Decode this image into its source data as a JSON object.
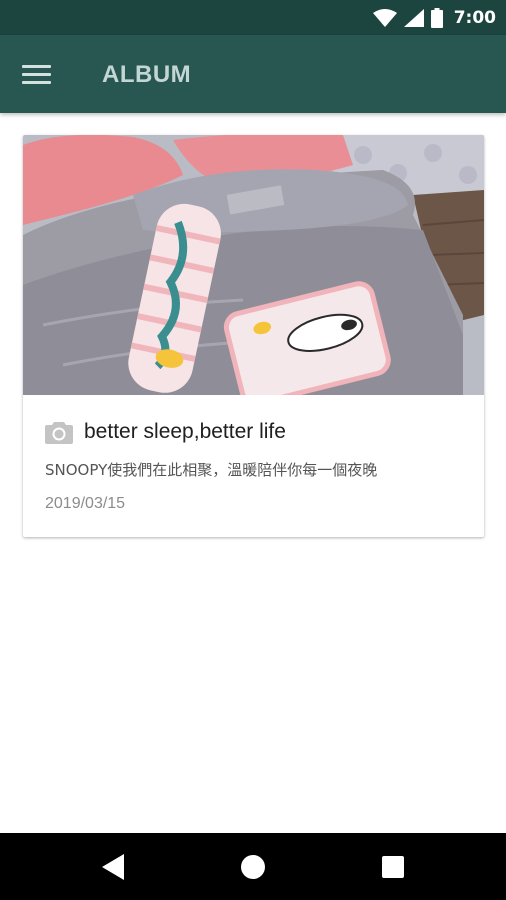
{
  "status_bar": {
    "time": "7:00",
    "icons": [
      "wifi-icon",
      "signal-icon",
      "battery-icon"
    ]
  },
  "app_bar": {
    "title": "ALBUM",
    "menu_icon": "hamburger-menu-icon"
  },
  "album": {
    "cards": [
      {
        "image": "photo of Snoopy-themed bedding and pillows on a bed",
        "icon": "camera-icon",
        "title": "better sleep,better life",
        "description": "SNOOPY使我們在此相聚，溫暖陪伴你每一個夜晚",
        "date": "2019/03/15"
      }
    ]
  },
  "nav_bar": {
    "back": "back-icon",
    "home": "home-icon",
    "recents": "recents-icon"
  },
  "colors": {
    "status_bar": "#1c4540",
    "app_bar": "#285752",
    "app_title": "#c4d6d3",
    "card_title": "#202020",
    "description": "#555555",
    "date": "#8c8c8c"
  }
}
